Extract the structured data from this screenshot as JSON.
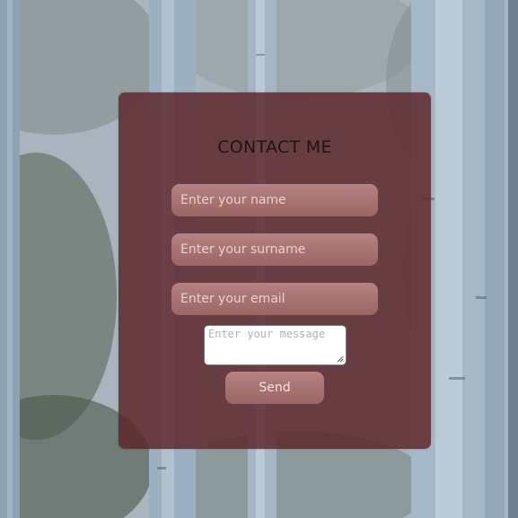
{
  "form": {
    "title": "CONTACT ME",
    "name_placeholder": "Enter your name",
    "surname_placeholder": "Enter your surname",
    "email_placeholder": "Enter your email",
    "message_placeholder": "Enter your message",
    "send_label": "Send"
  },
  "colors": {
    "panel": "#5c262a",
    "field": "#a87474",
    "title_text": "#1e1414"
  }
}
